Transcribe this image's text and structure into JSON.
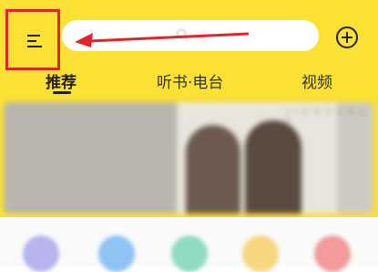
{
  "header": {
    "search": {
      "placeholder": "正"
    },
    "add_icon": "plus-circle-icon",
    "menu_icon": "hamburger-menu-icon"
  },
  "tabs": [
    {
      "label": "推荐",
      "active": true
    },
    {
      "label": "听书·电台",
      "active": false
    },
    {
      "label": "视频",
      "active": false
    }
  ],
  "banner": {
    "caption": "I I O O  S O N G S"
  },
  "shortcut_dots": [
    {
      "color": "#b7b4ee"
    },
    {
      "color": "#8fc3f4"
    },
    {
      "color": "#8fdcc2"
    },
    {
      "color": "#f7d680"
    },
    {
      "color": "#f39a9a"
    }
  ],
  "colors": {
    "accent": "#fbe134",
    "annotation": "#e0262b"
  }
}
